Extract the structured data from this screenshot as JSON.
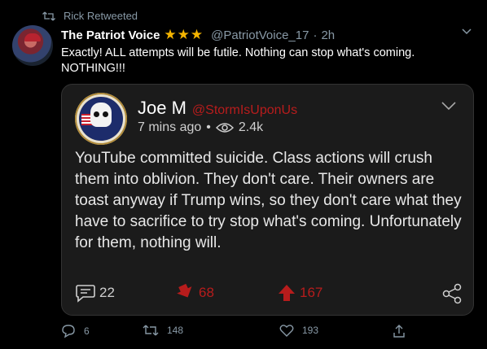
{
  "retweet_context": {
    "label": "Rick Retweeted",
    "icon": "retweet-icon"
  },
  "tweet": {
    "author_name": "The Patriot Voice",
    "author_badges": "★★★",
    "author_handle": "@PatriotVoice_17",
    "separator": "·",
    "time": "2h",
    "text_line_1": "Exactly! ALL attempts will be futile. Nothing can stop what's coming.",
    "text_line_2": "NOTHING!!!"
  },
  "embedded_card": {
    "author_name": "Joe M",
    "author_handle": "@StormIsUponUs",
    "time": "7 mins ago",
    "dot": "•",
    "views": "2.4k",
    "body": "YouTube committed suicide. Class actions will crush them into oblivion. They don't care. Their owners are toast anyway if Trump wins, so they don't care what they have to sacrifice to try stop what's coming. Unfortunately for them, nothing will.",
    "comments": "22",
    "downvotes": "68",
    "upvotes": "167",
    "accent_color": "#b71c1c"
  },
  "tweet_actions": {
    "replies": "6",
    "retweets": "148",
    "likes": "193"
  },
  "colors": {
    "background": "#000000",
    "card_background": "#1b1b1b",
    "muted": "#8899a6",
    "star": "#f4b400"
  }
}
